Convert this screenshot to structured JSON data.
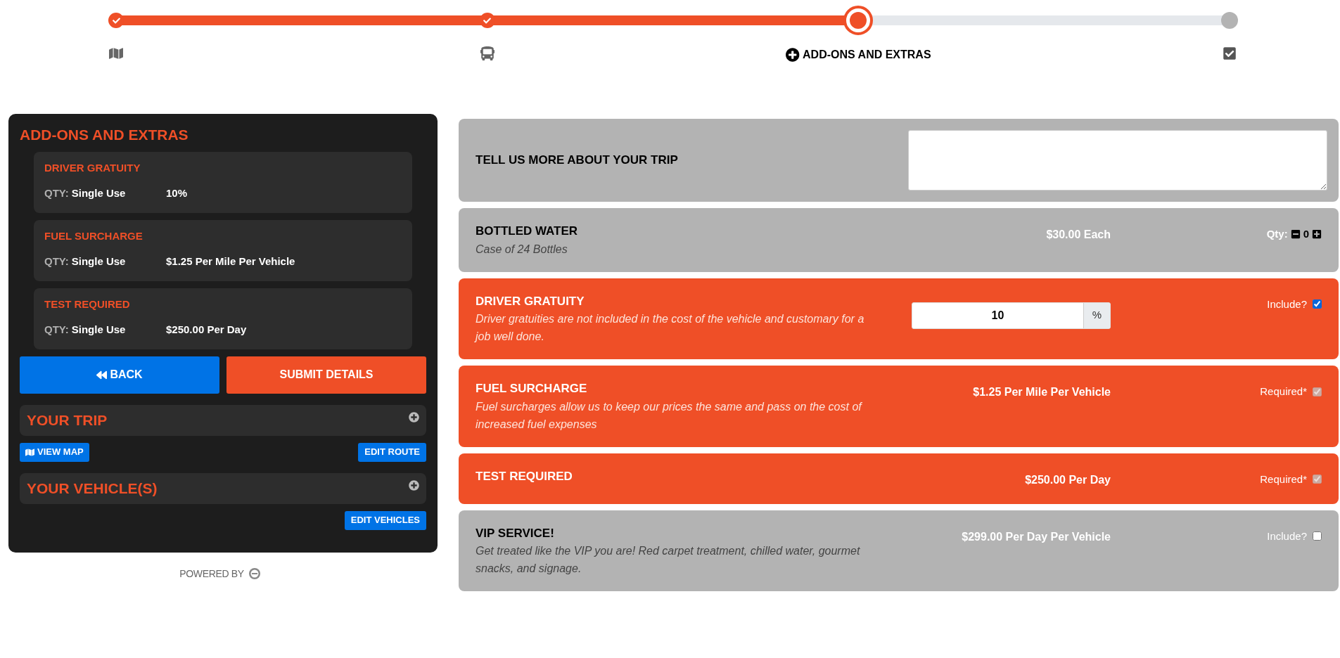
{
  "steps": [
    {
      "kind": "map",
      "completed": true,
      "selected": false
    },
    {
      "kind": "bus",
      "completed": true,
      "selected": false
    },
    {
      "kind": "add",
      "label": "ADD-ONS AND EXTRAS",
      "completed": false,
      "selected": true
    },
    {
      "kind": "review",
      "completed": false,
      "selected": false
    }
  ],
  "summary": {
    "title": "ADD-ONS AND EXTRAS",
    "items": [
      {
        "name": "DRIVER GRATUITY",
        "qty_label": "QTY:",
        "qty": "Single Use",
        "price": "10%"
      },
      {
        "name": "FUEL SURCHARGE",
        "qty_label": "QTY:",
        "qty": "Single Use",
        "price": "$1.25 Per Mile Per Vehicle"
      },
      {
        "name": "TEST REQUIRED",
        "qty_label": "QTY:",
        "qty": "Single Use",
        "price": "$250.00 Per Day"
      }
    ],
    "back_button": "BACK",
    "submit_button": "SUBMIT DETAILS",
    "sections": [
      {
        "title": "YOUR TRIP",
        "expanded": false,
        "actions": [
          {
            "kind": "map",
            "label": "VIEW MAP"
          },
          {
            "kind": "edit",
            "label": "EDIT ROUTE"
          }
        ]
      },
      {
        "title": "YOUR VEHICLE(S)",
        "expanded": false,
        "actions": [
          {
            "kind": "edit",
            "label": "EDIT VEHICLES"
          }
        ]
      }
    ],
    "powered_by": "POWERED BY"
  },
  "addons": [
    {
      "kind": "notes",
      "title": "TELL US MORE ABOUT YOUR TRIP",
      "selected": false
    },
    {
      "kind": "quantity",
      "title": "BOTTLED WATER",
      "subtitle": "Case of 24 Bottles",
      "price": "$30.00 Each",
      "qty_label": "Qty:",
      "qty": "0",
      "selected": false
    },
    {
      "kind": "percent",
      "title": "DRIVER GRATUITY",
      "subtitle": "Driver gratuities are not included in the cost of the vehicle and customary for a job well done.",
      "value": "10",
      "unit": "%",
      "option_label": "Include?",
      "checked": true,
      "disabled": false,
      "selected": true
    },
    {
      "kind": "option",
      "title": "FUEL SURCHARGE",
      "subtitle": "Fuel surcharges allow us to keep our prices the same and pass on the cost of increased fuel expenses",
      "price": "$1.25 Per Mile Per Vehicle",
      "option_label": "Required*",
      "checked": true,
      "disabled": true,
      "selected": true
    },
    {
      "kind": "option",
      "title": "TEST REQUIRED",
      "price": "$250.00 Per Day",
      "option_label": "Required*",
      "checked": true,
      "disabled": true,
      "selected": true
    },
    {
      "kind": "option",
      "title": "VIP SERVICE!",
      "subtitle": "Get treated like the VIP you are! Red carpet treatment, chilled water, gourmet snacks, and signage.",
      "price": "$299.00 Per Day Per Vehicle",
      "option_label": "Include?",
      "checked": false,
      "disabled": false,
      "selected": false
    }
  ]
}
